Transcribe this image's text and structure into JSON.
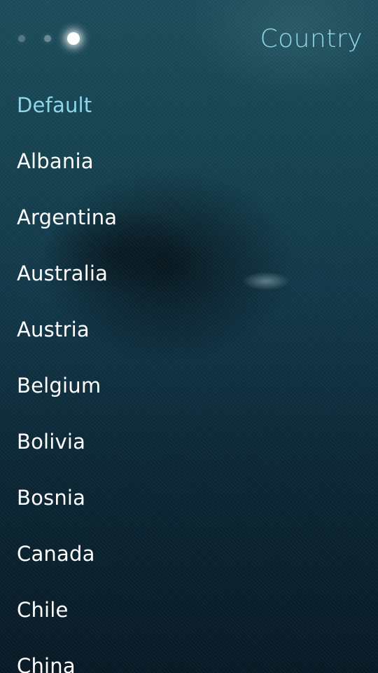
{
  "header": {
    "title": "Country",
    "page_indicator": {
      "dots": 3,
      "active_index": 2
    }
  },
  "list": {
    "items": [
      {
        "label": "Default",
        "selected": true
      },
      {
        "label": "Albania",
        "selected": false
      },
      {
        "label": "Argentina",
        "selected": false
      },
      {
        "label": "Australia",
        "selected": false
      },
      {
        "label": "Austria",
        "selected": false
      },
      {
        "label": "Belgium",
        "selected": false
      },
      {
        "label": "Bolivia",
        "selected": false
      },
      {
        "label": "Bosnia",
        "selected": false
      },
      {
        "label": "Canada",
        "selected": false
      },
      {
        "label": "Chile",
        "selected": false
      },
      {
        "label": "China",
        "selected": false
      }
    ]
  },
  "colors": {
    "accent": "#8fd6ea",
    "text": "#ffffff",
    "background_top": "#1d4d5c",
    "background_bottom": "#081a26"
  }
}
